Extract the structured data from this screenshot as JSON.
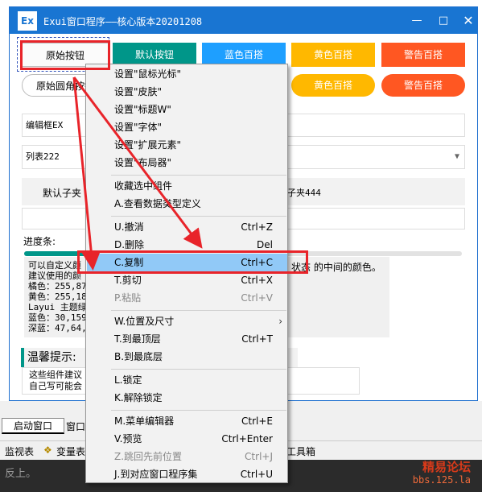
{
  "window": {
    "icon_text": "Ex",
    "title": "Exui窗口程序——核心版本20201208",
    "min_glyph": "—",
    "max_glyph": "□",
    "close_glyph": "✕"
  },
  "buttons_row1": {
    "original": "原始按钮",
    "default": "默认按钮",
    "blue": "蓝色百搭",
    "yellow": "黄色百搭",
    "warning": "警告百搭"
  },
  "buttons_row2": {
    "original_round": "原始圆角按钮",
    "yellow": "黄色百搭",
    "warning": "警告百搭"
  },
  "editbox": {
    "value": "编辑框EX"
  },
  "listbox": {
    "value": "列表222"
  },
  "tabs": {
    "first": "默认子夹",
    "fourth": "子夹444"
  },
  "progress": {
    "label": "进度条:",
    "value_fraction": 0.15
  },
  "info": {
    "lines": [
      "可以自定义颜",
      "建议使用的颜",
      "橘色：255,87",
      "黄色：255,18",
      "Layui 主题绿",
      "蓝色：30,159",
      "深蓝：47,64,"
    ],
    "right_text": "状态 的中间的颜色。"
  },
  "tip": {
    "heading": "温馨提示:",
    "line1": "这些组件建议",
    "line2": "自己写可能会"
  },
  "ide": {
    "tab_start": "启动窗口",
    "tab_win": "窗口",
    "bottom_monitor": "监视表",
    "bottom_vars": "变量表",
    "bottom_toolbox": "工具箱",
    "status_text": "反上。"
  },
  "watermark": {
    "line1": "精易论坛",
    "line2": "bbs.125.la"
  },
  "context_menu": {
    "items": [
      {
        "label": "设置\"鼠标光标\""
      },
      {
        "label": "设置\"皮肤\""
      },
      {
        "label": "设置\"标题W\""
      },
      {
        "label": "设置\"字体\""
      },
      {
        "label": "设置\"扩展元素\""
      },
      {
        "label": "设置\"布局器\""
      },
      {
        "label": "收藏选中组件"
      },
      {
        "label": "A.查看数据类型定义"
      },
      {
        "label": "U.撤消",
        "shortcut": "Ctrl+Z"
      },
      {
        "label": "D.删除",
        "shortcut": "Del"
      },
      {
        "label": "C.复制",
        "shortcut": "Ctrl+C"
      },
      {
        "label": "T.剪切",
        "shortcut": "Ctrl+X"
      },
      {
        "label": "P.粘贴",
        "shortcut": "Ctrl+V"
      },
      {
        "label": "W.位置及尺寸",
        "submenu": "›"
      },
      {
        "label": "T.到最顶层",
        "shortcut": "Ctrl+T"
      },
      {
        "label": "B.到最底层"
      },
      {
        "label": "L.锁定"
      },
      {
        "label": "K.解除锁定"
      },
      {
        "label": "M.菜单编辑器",
        "shortcut": "Ctrl+E"
      },
      {
        "label": "V.预览",
        "shortcut": "Ctrl+Enter"
      },
      {
        "label": "Z.跳回先前位置",
        "shortcut": "Ctrl+J"
      },
      {
        "label": "J.到对应窗口程序集",
        "shortcut": "Ctrl+U"
      }
    ]
  }
}
